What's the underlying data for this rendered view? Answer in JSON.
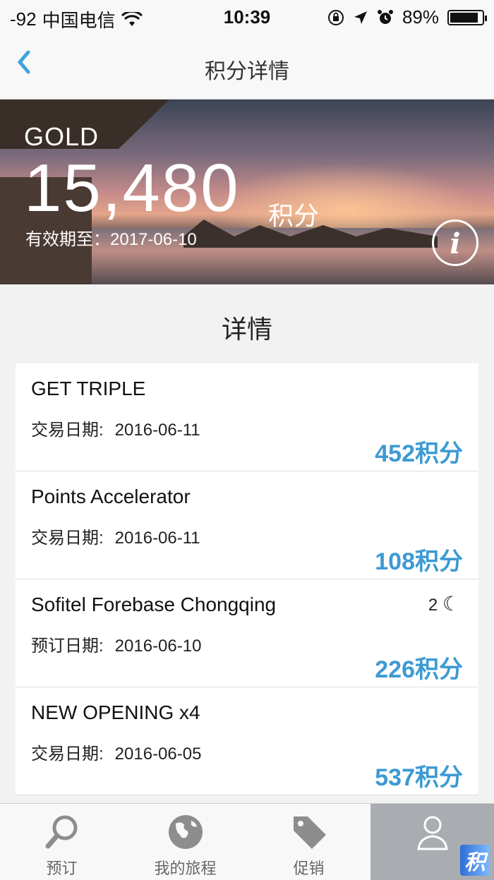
{
  "status_bar": {
    "signal": "-92",
    "carrier": "中国电信",
    "time": "10:39",
    "battery_percent": "89%",
    "battery_level": 89
  },
  "nav": {
    "title": "积分详情",
    "back_icon": "chevron-left-icon"
  },
  "hero": {
    "tier": "GOLD",
    "points": "15,480",
    "points_unit": "积分",
    "expiry_label": "有效期至：",
    "expiry_date": "2017-06-10",
    "info_label": "i"
  },
  "section_title": "详情",
  "transactions": [
    {
      "name": "GET TRIPLE",
      "date_label": "交易日期:",
      "date": "2016-06-11",
      "points": "452积分"
    },
    {
      "name": "Points Accelerator",
      "date_label": "交易日期:",
      "date": "2016-06-11",
      "points": "108积分"
    },
    {
      "name": "Sofitel Forebase Chongqing",
      "date_label": "预订日期:",
      "date": "2016-06-10",
      "points": "226积分",
      "nights": "2"
    },
    {
      "name": "NEW OPENING x4",
      "date_label": "交易日期:",
      "date": "2016-06-05",
      "points": "537积分"
    }
  ],
  "tabs": [
    {
      "label": "预订",
      "icon": "search-icon"
    },
    {
      "label": "我的旅程",
      "icon": "globe-icon"
    },
    {
      "label": "促销",
      "icon": "tag-icon"
    },
    {
      "label": "",
      "icon": "person-icon"
    }
  ],
  "colors": {
    "accent": "#3fa4df",
    "points_blue": "#3d9ad4",
    "active_tab": "#a9acb1"
  },
  "watermark": "积"
}
